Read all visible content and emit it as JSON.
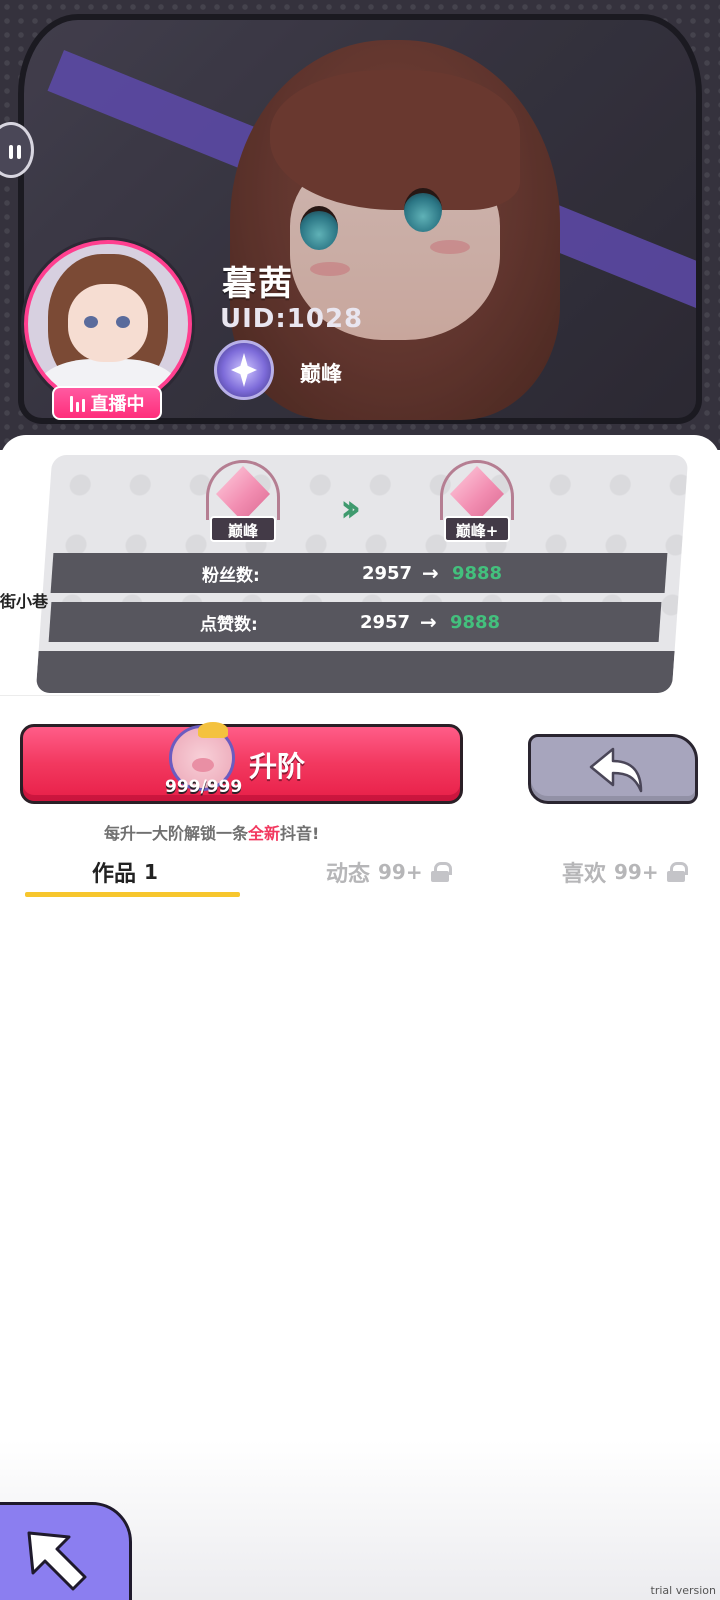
{
  "profile": {
    "name": "暮茜",
    "uid": "UID:1028",
    "rank": "巅峰",
    "live_label": "直播中"
  },
  "upgrade_panel": {
    "from_rank": "巅峰",
    "to_rank": "巅峰+",
    "side_tag": "街小巷",
    "stats": [
      {
        "label": "粉丝数:",
        "from": "2957",
        "arrow": "→",
        "to": "9888"
      },
      {
        "label": "点赞数:",
        "from": "2957",
        "arrow": "→",
        "to": "9888"
      }
    ]
  },
  "actions": {
    "upgrade_label": "升阶",
    "upgrade_count": "999/999",
    "hint_prefix": "每升一大阶解锁一条",
    "hint_highlight": "全新",
    "hint_suffix": "抖音!"
  },
  "tabs": [
    {
      "label": "作品",
      "count": "1",
      "locked": false,
      "active": true
    },
    {
      "label": "动态",
      "count": "99+",
      "locked": true,
      "active": false
    },
    {
      "label": "喜欢",
      "count": "99+",
      "locked": true,
      "active": false
    }
  ],
  "watermark": "trial version",
  "colors": {
    "accent_pink": "#f2385f",
    "live_pink": "#ff2e7b",
    "increase_green": "#43c07d",
    "tab_underline": "#f7c62d",
    "float_button": "#8b7ef0"
  },
  "icons": {
    "back": "back-arrow-icon",
    "float": "cursor-arrow-icon",
    "lock": "lock-icon",
    "live": "live-bars-icon"
  }
}
